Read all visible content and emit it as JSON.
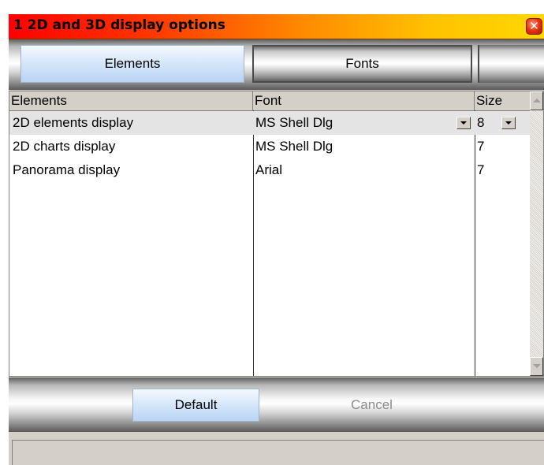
{
  "window": {
    "title": "1  2D and 3D display options",
    "close_glyph": "✕"
  },
  "tabs": [
    {
      "label": "Elements",
      "active": true
    },
    {
      "label": "Fonts",
      "active": false
    }
  ],
  "grid": {
    "columns": [
      "Elements",
      "Font",
      "Size"
    ],
    "rows": [
      {
        "element": "2D elements display",
        "font": "MS Shell Dlg",
        "size": "8",
        "selected": true
      },
      {
        "element": "2D charts display",
        "font": "MS Shell Dlg",
        "size": "7",
        "selected": false
      },
      {
        "element": "Panorama display",
        "font": "Arial",
        "size": "7",
        "selected": false
      }
    ]
  },
  "buttons": {
    "default_label": "Default",
    "cancel_label": "Cancel",
    "cancel_enabled": false
  },
  "colors": {
    "title_gradient_start": "#ff0000",
    "title_gradient_end": "#ffd700",
    "active_button": "#d8e8fb",
    "selected_row": "#e4e4e4"
  },
  "icons": {
    "close": "close-icon",
    "dropdown": "chevron-down-icon",
    "scroll_up": "scroll-up-arrow-icon",
    "scroll_down": "scroll-down-arrow-icon"
  }
}
